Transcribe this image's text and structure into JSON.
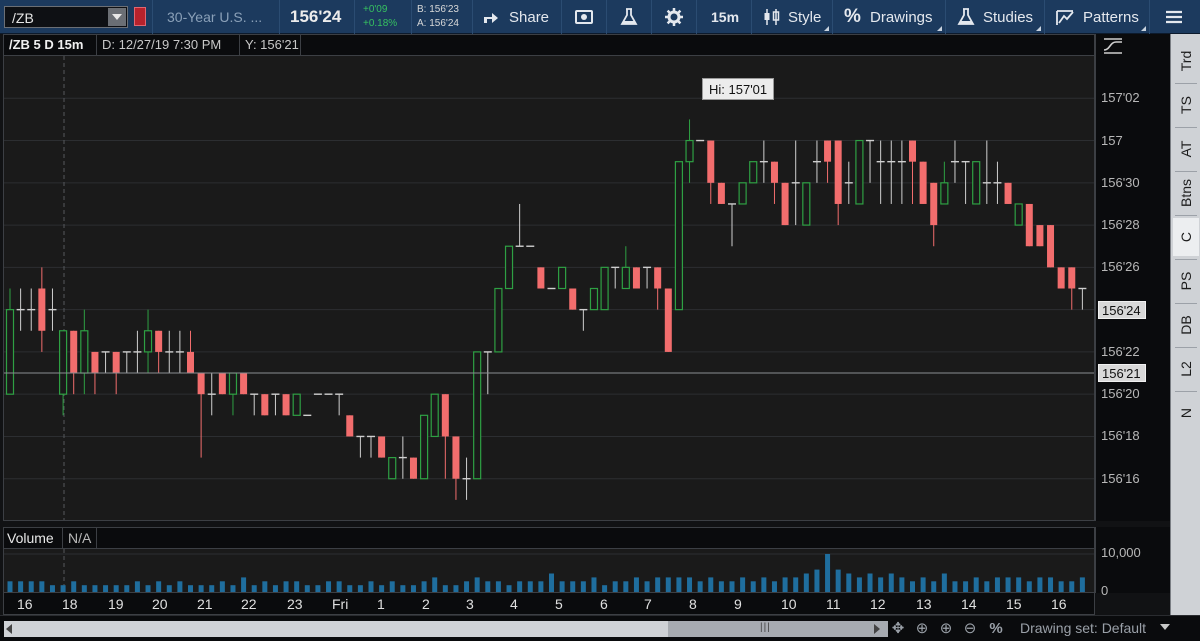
{
  "toolbar": {
    "symbol": "/ZB",
    "description": "30-Year U.S. ...",
    "last_price": "156'24",
    "net_change": "+0'09",
    "pct_change": "+0.18%",
    "bid": "B: 156'23",
    "ask": "A: 156'24",
    "share_label": "Share",
    "timeframe": "15m",
    "style_label": "Style",
    "drawings_label": "Drawings",
    "studies_label": "Studies",
    "patterns_label": "Patterns"
  },
  "chart_header": {
    "symbol_period": "/ZB 5 D 15m",
    "cursor_date": "D: 12/27/19 7:30 PM",
    "cursor_value": "Y: 156'21"
  },
  "price_axis": {
    "ticks": [
      "157'02",
      "157",
      "156'30",
      "156'28",
      "156'26",
      "156'24",
      "156'22",
      "156'20",
      "156'18",
      "156'16"
    ],
    "last_price_tag": "156'24",
    "cursor_tag": "156'21"
  },
  "hi_label": "Hi: 157'01",
  "volume": {
    "title": "Volume",
    "value": "N/A",
    "axis_ticks": [
      "10,000",
      "0"
    ]
  },
  "time_axis": {
    "labels": [
      "16",
      "18",
      "19",
      "20",
      "21",
      "22",
      "23",
      "Fri",
      "1",
      "2",
      "3",
      "4",
      "5",
      "6",
      "7",
      "8",
      "9",
      "10",
      "11",
      "12",
      "13",
      "14",
      "15",
      "16"
    ]
  },
  "bottom_bar": {
    "drawing_set": "Drawing set: Default",
    "scroll_grip": "|||"
  },
  "side_panel": {
    "tabs": [
      "Trd",
      "TS",
      "AT",
      "Btns",
      "C",
      "PS",
      "DB",
      "L2",
      "N"
    ],
    "active_tab": "C"
  },
  "colors": {
    "up": "#2ea043",
    "down": "#f26d6d",
    "volume": "#1f6e9e",
    "toolbar_bg": "#1c3a5e"
  },
  "chart_data": {
    "type": "candlestick",
    "title": "/ZB 5 D 15m",
    "xlabel": "",
    "ylabel": "",
    "y_unit": "32nds (fractional price)",
    "ylim": [
      156.45,
      157.1
    ],
    "bars": [
      [
        "up",
        156.625,
        156.75,
        156.6875,
        156.78125
      ],
      [
        "flat",
        156.75,
        156.75,
        156.71875,
        156.78125
      ],
      [
        "flat",
        156.75,
        156.75,
        156.71875,
        156.78125
      ],
      [
        "down",
        156.78125,
        156.71875,
        156.6875,
        156.8125
      ],
      [
        "flat",
        156.75,
        156.75,
        156.71875,
        156.78125
      ],
      [
        "up",
        156.625,
        156.71875,
        156.59375,
        156.71875
      ],
      [
        "down",
        156.71875,
        156.65625,
        156.625,
        156.71875
      ],
      [
        "up",
        156.65625,
        156.71875,
        156.625,
        156.75
      ],
      [
        "down",
        156.6875,
        156.65625,
        156.625,
        156.6875
      ],
      [
        "flat",
        156.6875,
        156.6875,
        156.65625,
        156.6875
      ],
      [
        "down",
        156.6875,
        156.65625,
        156.625,
        156.6875
      ],
      [
        "flat",
        156.6875,
        156.6875,
        156.65625,
        156.6875
      ],
      [
        "flat",
        156.6875,
        156.6875,
        156.65625,
        156.71875
      ],
      [
        "up",
        156.6875,
        156.71875,
        156.65625,
        156.75
      ],
      [
        "down",
        156.71875,
        156.6875,
        156.65625,
        156.71875
      ],
      [
        "flat",
        156.6875,
        156.6875,
        156.65625,
        156.71875
      ],
      [
        "flat",
        156.6875,
        156.6875,
        156.65625,
        156.71875
      ],
      [
        "down",
        156.6875,
        156.65625,
        156.65625,
        156.71875
      ],
      [
        "down",
        156.65625,
        156.625,
        156.53125,
        156.65625
      ],
      [
        "flat",
        156.625,
        156.625,
        156.59375,
        156.65625
      ],
      [
        "down",
        156.65625,
        156.625,
        156.625,
        156.65625
      ],
      [
        "up",
        156.625,
        156.65625,
        156.59375,
        156.65625
      ],
      [
        "down",
        156.65625,
        156.625,
        156.625,
        156.65625
      ],
      [
        "flat",
        156.625,
        156.625,
        156.59375,
        156.625
      ],
      [
        "down",
        156.625,
        156.59375,
        156.59375,
        156.625
      ],
      [
        "flat",
        156.625,
        156.625,
        156.59375,
        156.625
      ],
      [
        "down",
        156.625,
        156.59375,
        156.59375,
        156.625
      ],
      [
        "up",
        156.59375,
        156.625,
        156.59375,
        156.625
      ],
      [
        "flat",
        156.59375,
        156.59375,
        156.59375,
        156.59375
      ],
      [
        "flat",
        156.625,
        156.625,
        156.625,
        156.625
      ],
      [
        "flat",
        156.625,
        156.625,
        156.625,
        156.625
      ],
      [
        "flat",
        156.625,
        156.625,
        156.59375,
        156.625
      ],
      [
        "down",
        156.59375,
        156.5625,
        156.5625,
        156.59375
      ],
      [
        "flat",
        156.5625,
        156.5625,
        156.53125,
        156.5625
      ],
      [
        "flat",
        156.5625,
        156.5625,
        156.53125,
        156.5625
      ],
      [
        "down",
        156.5625,
        156.53125,
        156.53125,
        156.5625
      ],
      [
        "up",
        156.5,
        156.53125,
        156.5,
        156.53125
      ],
      [
        "flat",
        156.53125,
        156.53125,
        156.5,
        156.5625
      ],
      [
        "down",
        156.53125,
        156.5,
        156.5,
        156.53125
      ],
      [
        "up",
        156.5,
        156.59375,
        156.5,
        156.59375
      ],
      [
        "up",
        156.5625,
        156.625,
        156.5625,
        156.625
      ],
      [
        "down",
        156.625,
        156.5625,
        156.5,
        156.625
      ],
      [
        "down",
        156.5625,
        156.5,
        156.46875,
        156.5625
      ],
      [
        "flat",
        156.5,
        156.5,
        156.46875,
        156.53125
      ],
      [
        "up",
        156.5,
        156.6875,
        156.5,
        156.6875
      ],
      [
        "flat",
        156.6875,
        156.6875,
        156.625,
        156.6875
      ],
      [
        "up",
        156.6875,
        156.78125,
        156.6875,
        156.78125
      ],
      [
        "up",
        156.78125,
        156.84375,
        156.78125,
        156.84375
      ],
      [
        "flat",
        156.84375,
        156.84375,
        156.84375,
        156.90625
      ],
      [
        "flat",
        156.84375,
        156.84375,
        156.84375,
        156.84375
      ],
      [
        "down",
        156.8125,
        156.78125,
        156.78125,
        156.8125
      ],
      [
        "flat",
        156.78125,
        156.78125,
        156.78125,
        156.78125
      ],
      [
        "up",
        156.78125,
        156.8125,
        156.78125,
        156.8125
      ],
      [
        "down",
        156.78125,
        156.75,
        156.75,
        156.78125
      ],
      [
        "flat",
        156.75,
        156.75,
        156.71875,
        156.75
      ],
      [
        "up",
        156.75,
        156.78125,
        156.75,
        156.78125
      ],
      [
        "up",
        156.75,
        156.8125,
        156.75,
        156.8125
      ],
      [
        "flat",
        156.8125,
        156.8125,
        156.78125,
        156.8125
      ],
      [
        "up",
        156.78125,
        156.8125,
        156.78125,
        156.84375
      ],
      [
        "down",
        156.8125,
        156.78125,
        156.78125,
        156.8125
      ],
      [
        "flat",
        156.8125,
        156.8125,
        156.78125,
        156.8125
      ],
      [
        "down",
        156.8125,
        156.78125,
        156.75,
        156.8125
      ],
      [
        "down",
        156.78125,
        156.6875,
        156.6875,
        156.78125
      ],
      [
        "up",
        156.75,
        156.96875,
        156.75,
        156.96875
      ],
      [
        "up",
        156.96875,
        157.0,
        156.9375,
        157.03125
      ],
      [
        "flat",
        157.0,
        157.0,
        157.0,
        157.0
      ],
      [
        "down",
        157.0,
        156.9375,
        156.90625,
        157.0
      ],
      [
        "down",
        156.9375,
        156.90625,
        156.90625,
        156.9375
      ],
      [
        "flat",
        156.90625,
        156.90625,
        156.84375,
        156.90625
      ],
      [
        "up",
        156.90625,
        156.9375,
        156.90625,
        156.9375
      ],
      [
        "up",
        156.9375,
        156.96875,
        156.9375,
        156.96875
      ],
      [
        "flat",
        156.96875,
        156.96875,
        156.9375,
        157.0
      ],
      [
        "down",
        156.96875,
        156.9375,
        156.90625,
        156.96875
      ],
      [
        "down",
        156.9375,
        156.875,
        156.875,
        156.9375
      ],
      [
        "flat",
        156.9375,
        156.9375,
        156.875,
        157.0
      ],
      [
        "up",
        156.875,
        156.9375,
        156.875,
        156.9375
      ],
      [
        "flat",
        156.96875,
        156.96875,
        156.9375,
        157.0
      ],
      [
        "down",
        157.0,
        156.96875,
        156.9375,
        157.0
      ],
      [
        "down",
        157.0,
        156.90625,
        156.875,
        157.0
      ],
      [
        "flat",
        156.9375,
        156.9375,
        156.90625,
        156.96875
      ],
      [
        "up",
        156.90625,
        157.0,
        156.90625,
        157.0
      ],
      [
        "flat",
        157.0,
        157.0,
        156.9375,
        157.0
      ],
      [
        "flat",
        156.96875,
        156.96875,
        156.90625,
        157.0
      ],
      [
        "flat",
        156.96875,
        156.96875,
        156.90625,
        157.0
      ],
      [
        "flat",
        156.96875,
        156.96875,
        156.90625,
        157.0
      ],
      [
        "down",
        157.0,
        156.96875,
        156.90625,
        157.0
      ],
      [
        "down",
        156.96875,
        156.90625,
        156.90625,
        156.96875
      ],
      [
        "down",
        156.9375,
        156.875,
        156.84375,
        156.9375
      ],
      [
        "up",
        156.90625,
        156.9375,
        156.90625,
        156.96875
      ],
      [
        "flat",
        156.96875,
        156.96875,
        156.9375,
        157.0
      ],
      [
        "flat",
        156.96875,
        156.96875,
        156.90625,
        156.96875
      ],
      [
        "up",
        156.90625,
        156.96875,
        156.90625,
        156.96875
      ],
      [
        "flat",
        156.9375,
        156.9375,
        156.90625,
        157.0
      ],
      [
        "flat",
        156.9375,
        156.9375,
        156.90625,
        156.96875
      ],
      [
        "down",
        156.9375,
        156.90625,
        156.90625,
        156.9375
      ],
      [
        "up",
        156.875,
        156.90625,
        156.875,
        156.90625
      ],
      [
        "down",
        156.90625,
        156.84375,
        156.84375,
        156.90625
      ],
      [
        "down",
        156.875,
        156.84375,
        156.84375,
        156.875
      ],
      [
        "down",
        156.875,
        156.8125,
        156.8125,
        156.875
      ],
      [
        "down",
        156.8125,
        156.78125,
        156.78125,
        156.8125
      ],
      [
        "down",
        156.8125,
        156.78125,
        156.75,
        156.8125
      ],
      [
        "flat",
        156.78125,
        156.78125,
        156.75,
        156.78125
      ]
    ],
    "volume": [
      3,
      3,
      3,
      3,
      2,
      2,
      3,
      2,
      2,
      2,
      2,
      2,
      3,
      2,
      3,
      2,
      3,
      2,
      2,
      2,
      3,
      2,
      4,
      2,
      3,
      2,
      3,
      3,
      2,
      2,
      3,
      3,
      2,
      2,
      3,
      2,
      3,
      2,
      2,
      3,
      4,
      2,
      2,
      3,
      4,
      3,
      3,
      2,
      3,
      3,
      3,
      5,
      3,
      3,
      3,
      4,
      2,
      3,
      3,
      4,
      3,
      4,
      4,
      4,
      4,
      3,
      4,
      3,
      3,
      4,
      3,
      4,
      3,
      4,
      4,
      5,
      6,
      10,
      6,
      5,
      4,
      5,
      4,
      5,
      4,
      3,
      4,
      3,
      5,
      3,
      3,
      4,
      3,
      4,
      4,
      4,
      3,
      4,
      4,
      3,
      3,
      4
    ]
  }
}
